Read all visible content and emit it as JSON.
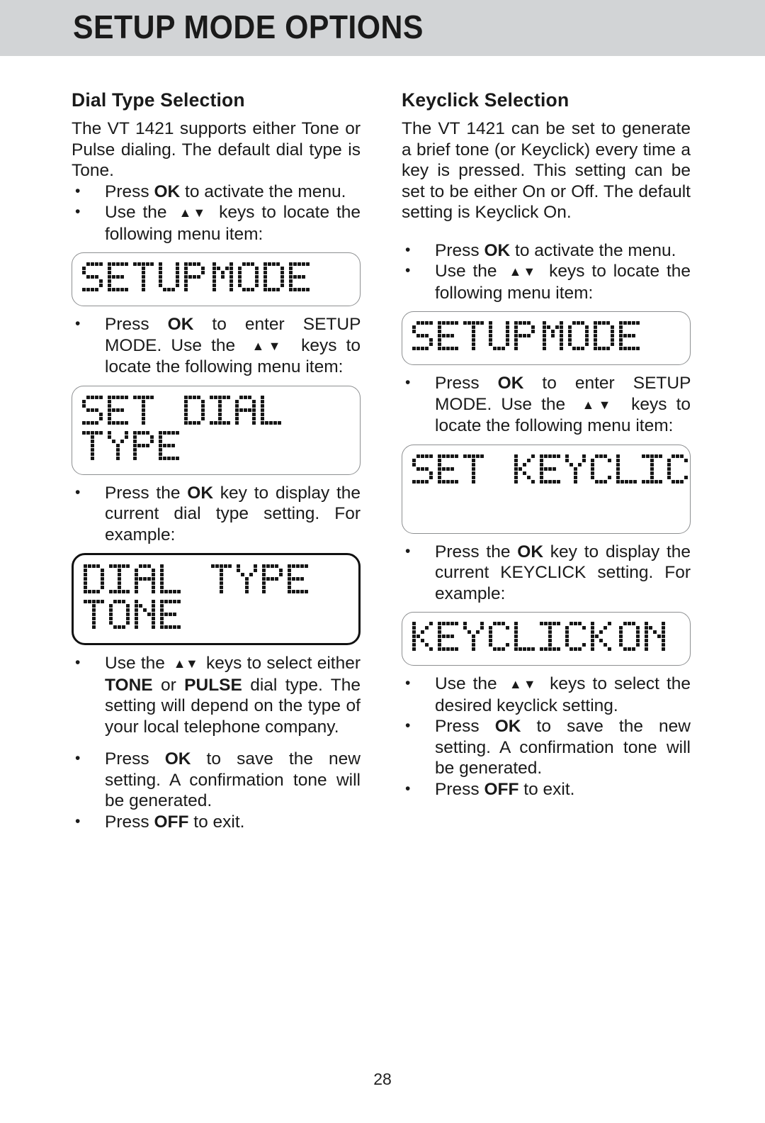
{
  "header": {
    "title": "SETUP MODE OPTIONS",
    "band_color": "#d2d4d6"
  },
  "left_column": {
    "heading": "Dial Type Selection",
    "intro": "The VT 1421 supports either Tone or Pulse dialing.  The default dial type is Tone.",
    "bullets_1": [
      "Press OK to activate the menu.",
      "Use the ▲▼ keys to locate the following menu item:"
    ],
    "display_1": {
      "line1": "SETUP",
      "line2": "MODE",
      "border": "thin"
    },
    "bullets_2": [
      "Press OK to enter SETUP MODE. Use the ▲▼ keys to locate the following menu item:"
    ],
    "display_2": {
      "line1": "SET DIAL",
      "line2": "TYPE",
      "border": "thin"
    },
    "bullets_3": [
      "Press the OK key to display the current dial type setting.  For example:"
    ],
    "display_3": {
      "line1": "DIAL TYPE",
      "line2": "TONE",
      "border": "thick"
    },
    "bullets_4": [
      "Use the ▲▼ keys to select either TONE or PULSE dial type. The setting will depend on the type of your local telephone company.",
      "Press OK to save the new setting. A confirmation tone will be generated.",
      "Press OFF to exit."
    ]
  },
  "right_column": {
    "heading": "Keyclick Selection",
    "intro": "The VT 1421 can be set to generate a brief tone (or Keyclick) every time a key is pressed.  This setting can be set to be either On or Off.   The default setting is Keyclick On.",
    "bullets_1": [
      "Press OK to activate the menu.",
      "Use the ▲▼ keys to locate the following menu item:"
    ],
    "display_1": {
      "line1": "SETUP",
      "line2": "MODE",
      "border": "thin"
    },
    "bullets_2": [
      "Press OK to enter SETUP MODE. Use the ▲▼ keys to locate the following menu item:"
    ],
    "display_2": {
      "line1": "SET KEYCLICK",
      "line2": "",
      "border": "thin"
    },
    "bullets_3": [
      "Press the OK key to display the current KEYCLICK setting.  For example:"
    ],
    "display_3": {
      "line1": "KEYCLICK",
      "line2": "ON",
      "border": "thin"
    },
    "bullets_4": [
      "Use the ▲▼ keys to select the desired keyclick setting.",
      "Press OK to save the new setting. A confirmation tone will be generated.",
      "Press OFF to exit."
    ]
  },
  "footer": {
    "page_number": "28"
  }
}
